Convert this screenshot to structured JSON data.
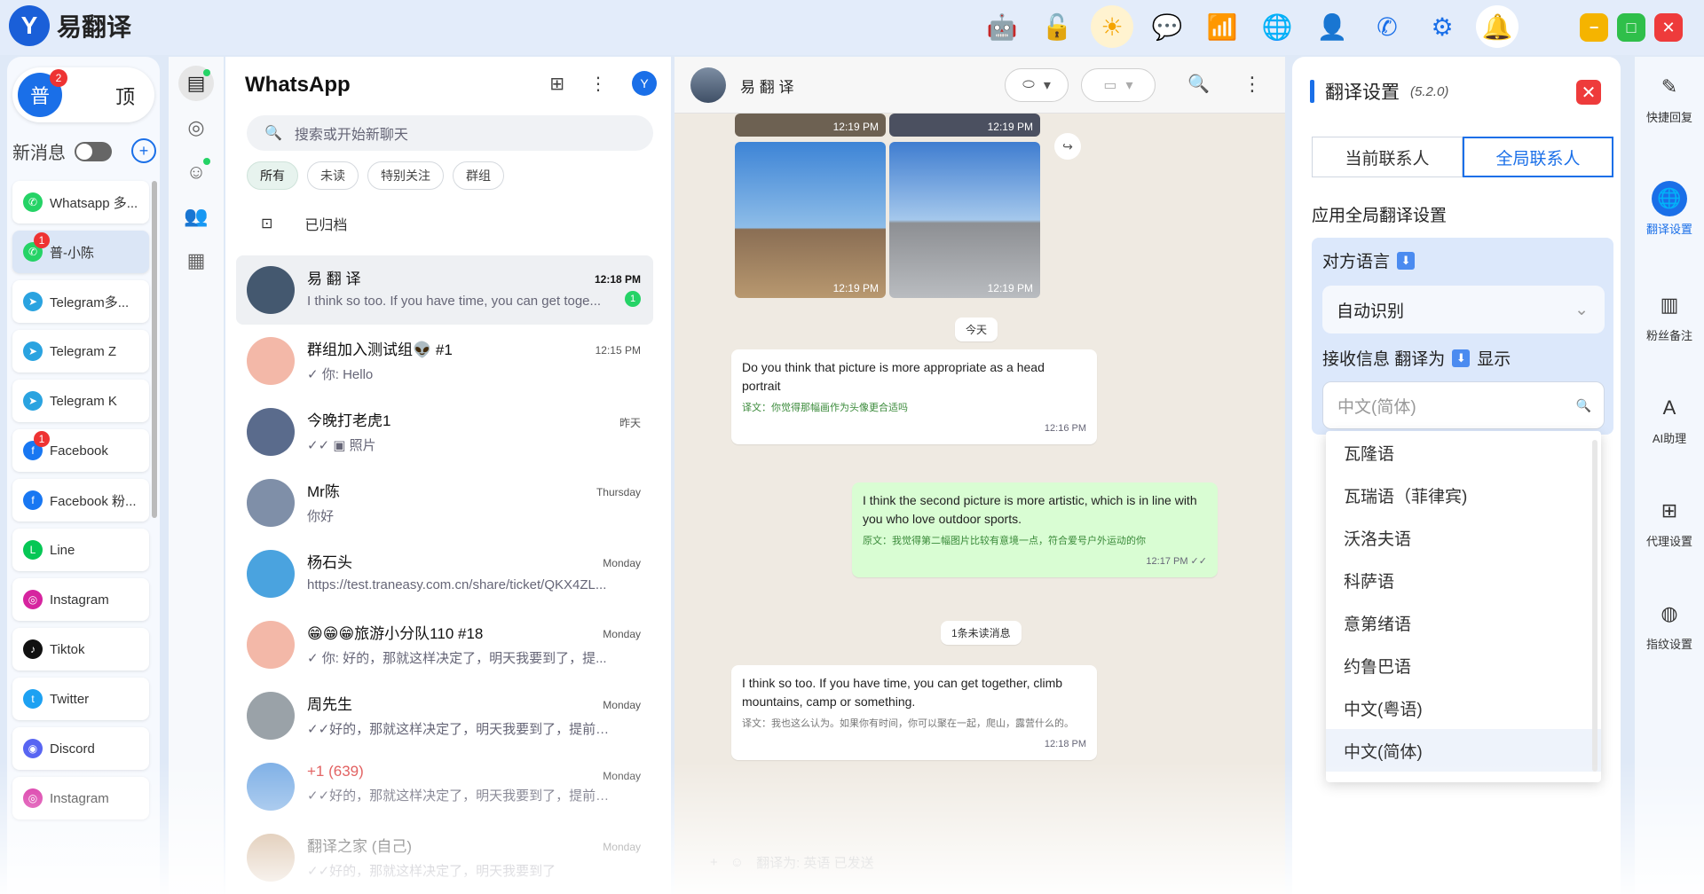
{
  "app": {
    "logo_glyph": "Y",
    "title": "易翻译"
  },
  "topbar": {
    "icons": [
      "robot-icon",
      "unlock-icon",
      "sun-icon",
      "chat-bubble-icon",
      "wifi-icon",
      "globe-icon",
      "user-icon",
      "phone-icon",
      "gear-icon",
      "bell-icon"
    ],
    "window": {
      "minimize": "−",
      "maximize": "□",
      "close": "✕"
    }
  },
  "left": {
    "pu_label": "普",
    "pu_badge": "2",
    "top_label": "顶",
    "new_msg_label": "新消息",
    "apps": [
      {
        "label": "Whatsapp 多...",
        "icon": "whatsapp-icon",
        "color": "#25d366",
        "badge": ""
      },
      {
        "label": "普-小陈",
        "icon": "whatsapp-icon",
        "color": "#25d366",
        "badge": "1",
        "active": true
      },
      {
        "label": "Telegram多...",
        "icon": "telegram-icon",
        "color": "#2aa3e0",
        "badge": ""
      },
      {
        "label": "Telegram Z",
        "icon": "telegram-icon",
        "color": "#2aa3e0",
        "badge": ""
      },
      {
        "label": "Telegram K",
        "icon": "telegram-icon",
        "color": "#2aa3e0",
        "badge": ""
      },
      {
        "label": "Facebook",
        "icon": "facebook-icon",
        "color": "#1877f2",
        "badge": "1"
      },
      {
        "label": "Facebook 粉...",
        "icon": "facebook-icon",
        "color": "#1877f2",
        "badge": ""
      },
      {
        "label": "Line",
        "icon": "line-icon",
        "color": "#06c755",
        "badge": ""
      },
      {
        "label": "Instagram",
        "icon": "instagram-icon",
        "color": "#d6249f",
        "badge": ""
      },
      {
        "label": "Tiktok",
        "icon": "tiktok-icon",
        "color": "#111111",
        "badge": ""
      },
      {
        "label": "Twitter",
        "icon": "twitter-icon",
        "color": "#1da1f2",
        "badge": ""
      },
      {
        "label": "Discord",
        "icon": "discord-icon",
        "color": "#5865f2",
        "badge": ""
      },
      {
        "label": "Instagram",
        "icon": "instagram-icon",
        "color": "#d6249f",
        "badge": ""
      }
    ]
  },
  "chatlist": {
    "title": "WhatsApp",
    "search_placeholder": "搜索或开始新聊天",
    "filters": [
      "所有",
      "未读",
      "特别关注",
      "群组"
    ],
    "archived": "已归档",
    "chats": [
      {
        "name": "易 翻 译",
        "time": "12:18 PM",
        "preview": "I think so too. If you have time, you can get toge...",
        "unread": "1",
        "avcolor": "#44586f"
      },
      {
        "name": "群组加入测试组👽 #1",
        "time": "12:15 PM",
        "preview": "✓ 你: Hello",
        "unread": "",
        "avcolor": "#f3b8a8"
      },
      {
        "name": "今晚打老虎1",
        "time": "昨天",
        "preview": "✓✓ ▣ 照片",
        "unread": "",
        "avcolor": "#5a6b8c"
      },
      {
        "name": "Mr陈",
        "time": "Thursday",
        "preview": "你好",
        "unread": "",
        "avcolor": "#7f8fa8"
      },
      {
        "name": "杨石头",
        "time": "Monday",
        "preview": "https://test.traneasy.com.cn/share/ticket/QKX4ZL...",
        "unread": "",
        "avcolor": "#4aa3df"
      },
      {
        "name": "😁😁😁旅游小分队110 #18",
        "time": "Monday",
        "preview": "✓ 你: 好的，那就这样决定了，明天我要到了，提...",
        "unread": "",
        "avcolor": "#f3b8a8"
      },
      {
        "name": "周先生",
        "time": "Monday",
        "preview": "✓✓好的，那就这样决定了，明天我要到了，提前通...",
        "unread": "",
        "avcolor": "#9aa2a8"
      },
      {
        "name": "+1 (639)",
        "time": "Monday",
        "preview": "✓✓好的，那就这样决定了，明天我要到了，提前通...",
        "unread": "",
        "avcolor": "#7fb0e6"
      },
      {
        "name": "翻译之家 (自己)",
        "time": "Monday",
        "preview": "✓✓好的，那就这样决定了，明天我要到了",
        "unread": "",
        "avcolor": "#c7a07a"
      }
    ]
  },
  "conversation": {
    "name": "易 翻 译",
    "photo_time": "12:19 PM",
    "date_today": "今天",
    "unread_chip": "1条未读消息",
    "messages": [
      {
        "text": "Do you think that picture is more appropriate as a head portrait",
        "translation": "译文：你觉得那幅画作为头像更合适吗",
        "time": "12:16 PM"
      },
      {
        "text": "I think the second picture is more artistic, which is in line with you who love outdoor sports.",
        "translation": "原文：我觉得第二幅图片比较有意境一点，符合爱号户外运动的你",
        "time": "12:17 PM ✓✓"
      },
      {
        "text": "I think so too. If you have time, you can get together, climb mountains, camp or something.",
        "translation": "译文：我也这么认为。如果你有时间，你可以聚在一起，爬山，露营什么的。",
        "time": "12:18 PM"
      }
    ],
    "input_placeholder": "翻译为: 英语 已发送"
  },
  "translate": {
    "title": "翻译设置",
    "version": "(5.2.0)",
    "tab_current": "当前联系人",
    "tab_global": "全局联系人",
    "apply_global": "应用全局翻译设置",
    "peer_lang_label": "对方语言",
    "peer_lang_value": "自动识别",
    "recv_label_a": "接收信息 翻译为",
    "recv_label_b": "显示",
    "recv_value": "中文(简体)",
    "options": [
      "瓦隆语",
      "瓦瑞语（菲律宾)",
      "沃洛夫语",
      "科萨语",
      "意第绪语",
      "约鲁巴语",
      "中文(粤语)",
      "中文(简体)"
    ]
  },
  "quick": [
    {
      "label": "快捷回复",
      "icon": "quick-reply-icon"
    },
    {
      "label": "翻译设置",
      "icon": "globe-icon",
      "active": true
    },
    {
      "label": "粉丝备注",
      "icon": "notes-icon"
    },
    {
      "label": "AI助理",
      "icon": "ai-assistant-icon"
    },
    {
      "label": "代理设置",
      "icon": "proxy-icon"
    },
    {
      "label": "指纹设置",
      "icon": "fingerprint-icon"
    }
  ]
}
